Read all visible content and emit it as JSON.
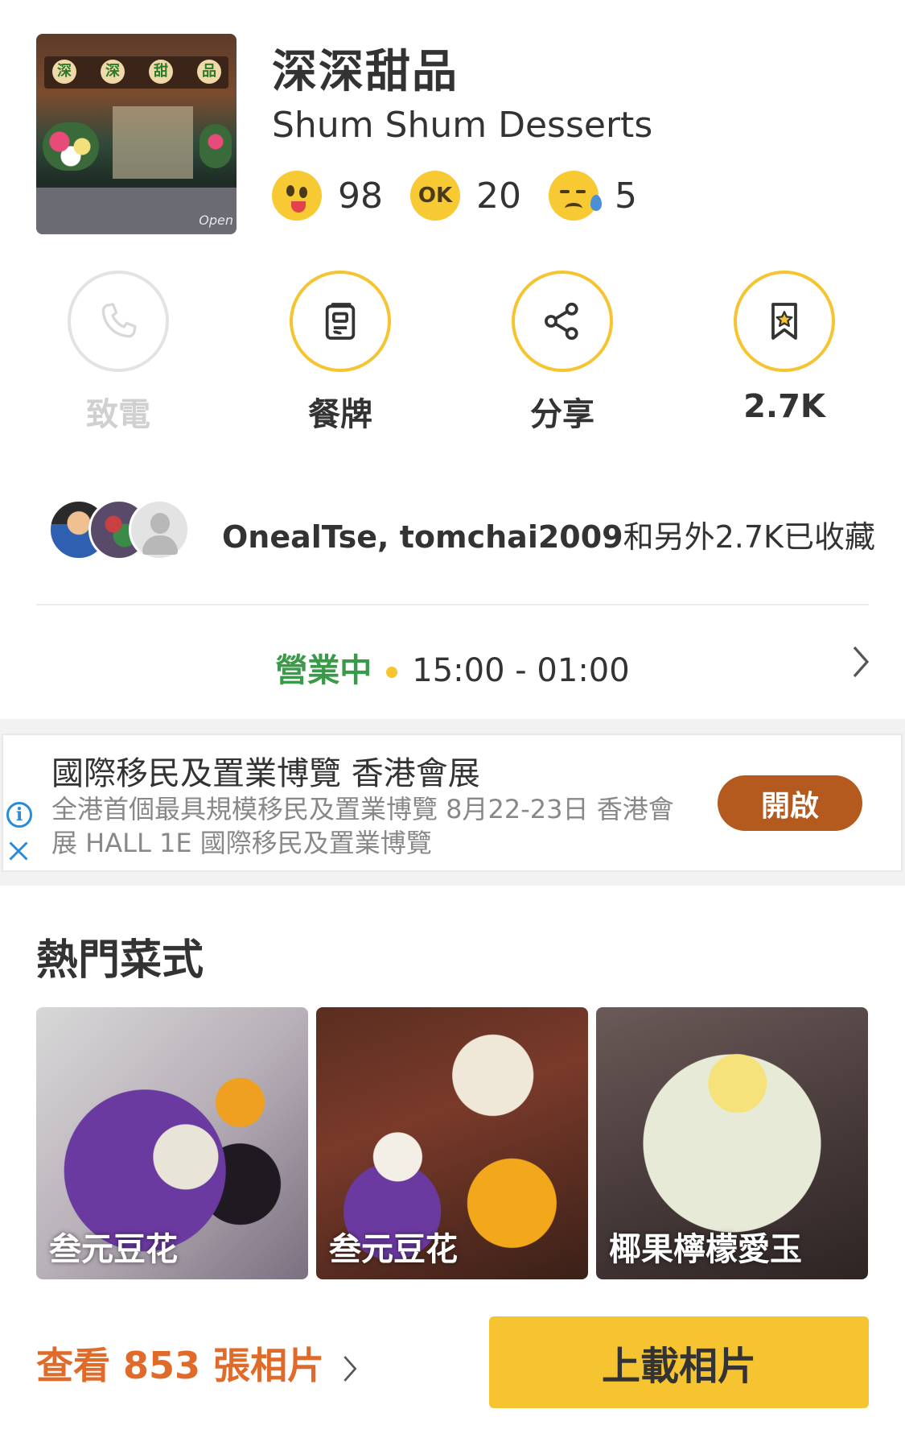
{
  "restaurant": {
    "name_zh": "深深甜品",
    "name_en": "Shum Shum Desserts",
    "photo_watermark": "Open",
    "sign_chars": [
      "深",
      "深",
      "甜",
      "品"
    ]
  },
  "ratings": {
    "good": "98",
    "ok": "20",
    "bad": "5",
    "ok_icon_text": "OK"
  },
  "actions": [
    {
      "label": "致電",
      "icon": "phone-icon",
      "enabled": false
    },
    {
      "label": "餐牌",
      "icon": "menu-icon",
      "enabled": true
    },
    {
      "label": "分享",
      "icon": "share-icon",
      "enabled": true
    },
    {
      "label": "2.7K",
      "icon": "bookmark-icon",
      "enabled": true
    }
  ],
  "bookmarks": {
    "users": "OnealTse, tomchai2009",
    "suffix": "和另外2.7K已收藏"
  },
  "hours": {
    "status": "營業中",
    "time": "15:00 - 01:00"
  },
  "ad": {
    "title": "國際移民及置業博覽 香港會展",
    "description": "全港首個最具規模移民及置業博覽 8月22-23日 香港會展 HALL 1E 國際移民及置業博覽",
    "button": "開啟"
  },
  "popular": {
    "title": "熱門菜式",
    "dishes": [
      "叁元豆花",
      "叁元豆花",
      "椰果檸檬愛玉"
    ]
  },
  "footer": {
    "view_photos": "查看 853 張相片",
    "upload": "上載相片"
  },
  "colors": {
    "accent": "#f5c430",
    "open_green": "#3a9a4a",
    "photos_orange": "#e06a2a",
    "ad_button": "#b55a1f",
    "ad_icon_blue": "#2a8bd9"
  }
}
